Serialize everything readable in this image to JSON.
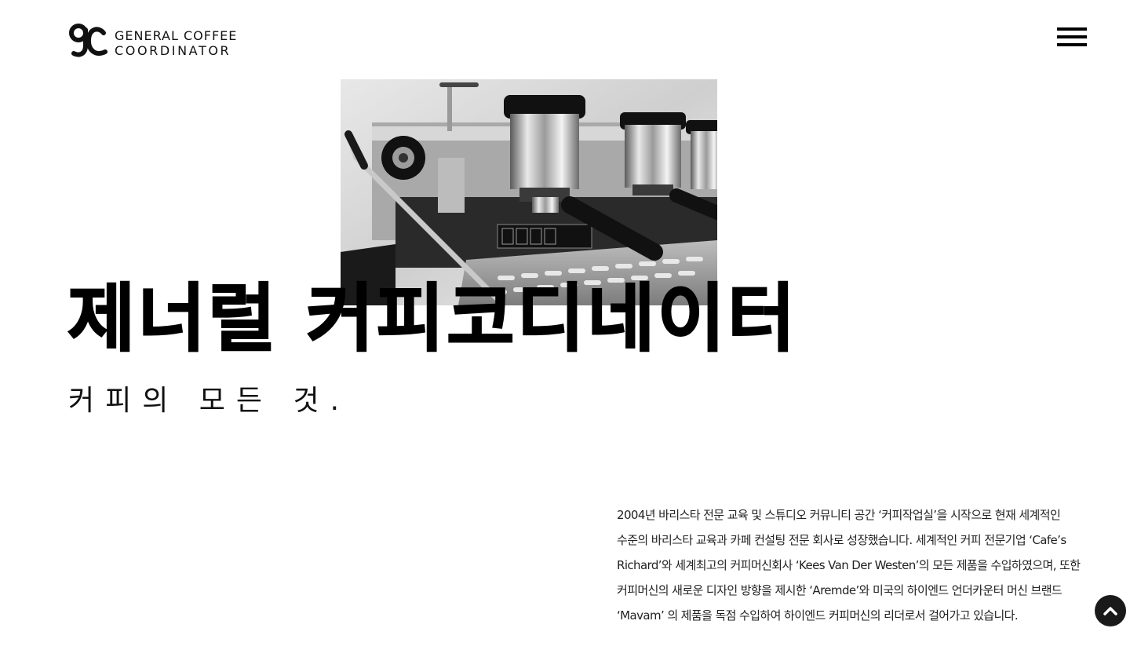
{
  "header": {
    "logo_line1": "GENERAL COFFEE",
    "logo_line2": "COORDINATOR",
    "logo_mark": "gc-monogram",
    "menu_icon": "hamburger-icon"
  },
  "hero": {
    "image_subject": "espresso-machine-photo",
    "title": "제너럴 커피코디네이터",
    "subtitle": "커피의 모든 것."
  },
  "description": {
    "text": "2004년 바리스타 전문 교육 및 스튜디오 커뮤니티 공간 ‘커피작업실’을 시작으로 현재 세계적인 수준의 바리스타 교육과 카페 컨설팅 전문 회사로 성장했습니다. 세계적인 커피 전문기업 ‘Cafe’s Richard’와 세계최고의 커피머신회사 ‘Kees Van Der Westen’의 모든 제품을 수입하였으며, 또한 커피머신의 새로운 디자인 방향을 제시한 ‘Aremde’와 미국의 하이엔드 언더카운터 머신 브랜드 ‘Mavam’ 의 제품을 독점 수입하여 하이엔드 커피머신의 리더로서 걸어가고 있습니다."
  },
  "scroll_top": {
    "icon": "chevron-up-icon"
  },
  "colors": {
    "background": "#ffffff",
    "text": "#000000",
    "scroll_button": "#1a1a1a"
  }
}
